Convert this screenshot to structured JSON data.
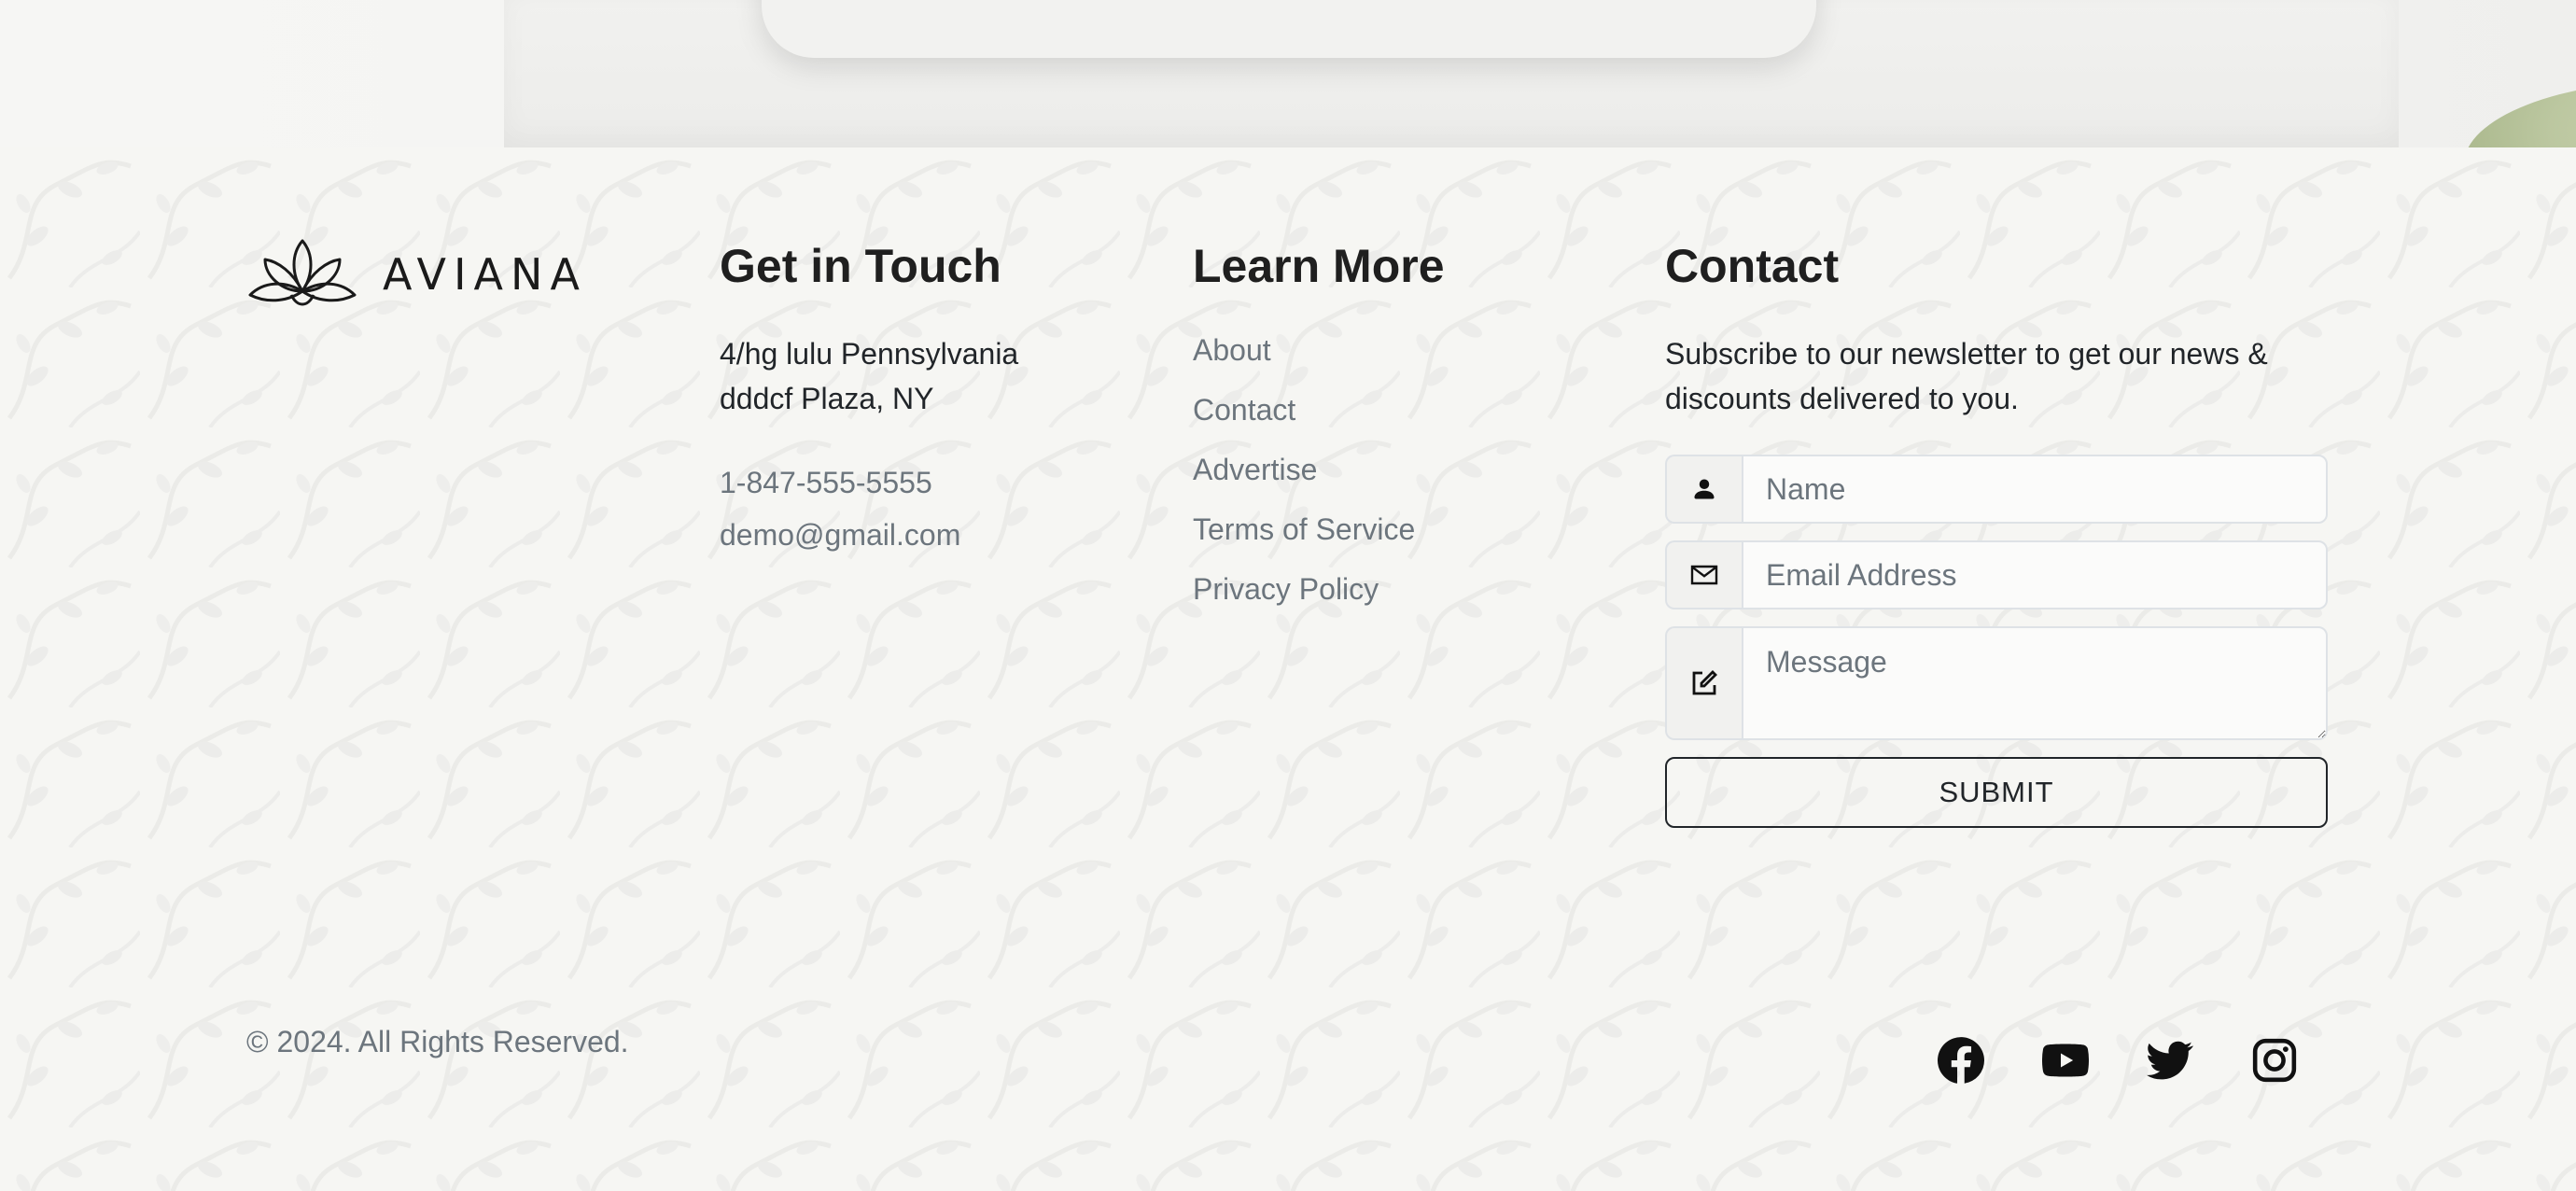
{
  "brand": {
    "name": "AVIANA"
  },
  "get_in_touch": {
    "heading": "Get in Touch",
    "address_line1": "4/hg lulu Pennsylvania",
    "address_line2": "dddcf Plaza, NY",
    "phone": "1-847-555-5555",
    "email": "demo@gmail.com"
  },
  "learn_more": {
    "heading": "Learn More",
    "links": [
      {
        "label": "About"
      },
      {
        "label": "Contact"
      },
      {
        "label": "Advertise"
      },
      {
        "label": "Terms of Service"
      },
      {
        "label": "Privacy Policy"
      }
    ]
  },
  "contact": {
    "heading": "Contact",
    "description": "Subscribe to our newsletter to get our news & discounts delivered to you.",
    "name_placeholder": "Name",
    "email_placeholder": "Email Address",
    "message_placeholder": "Message",
    "submit_label": "SUBMIT"
  },
  "footer": {
    "copyright": "© 2024. All Rights Reserved.",
    "socials": [
      {
        "icon": "facebook-icon"
      },
      {
        "icon": "youtube-icon"
      },
      {
        "icon": "twitter-icon"
      },
      {
        "icon": "instagram-icon"
      }
    ]
  },
  "colors": {
    "text": "#212529",
    "muted": "#6c757d",
    "border": "#dee2e6",
    "background": "#f6f6f3"
  }
}
